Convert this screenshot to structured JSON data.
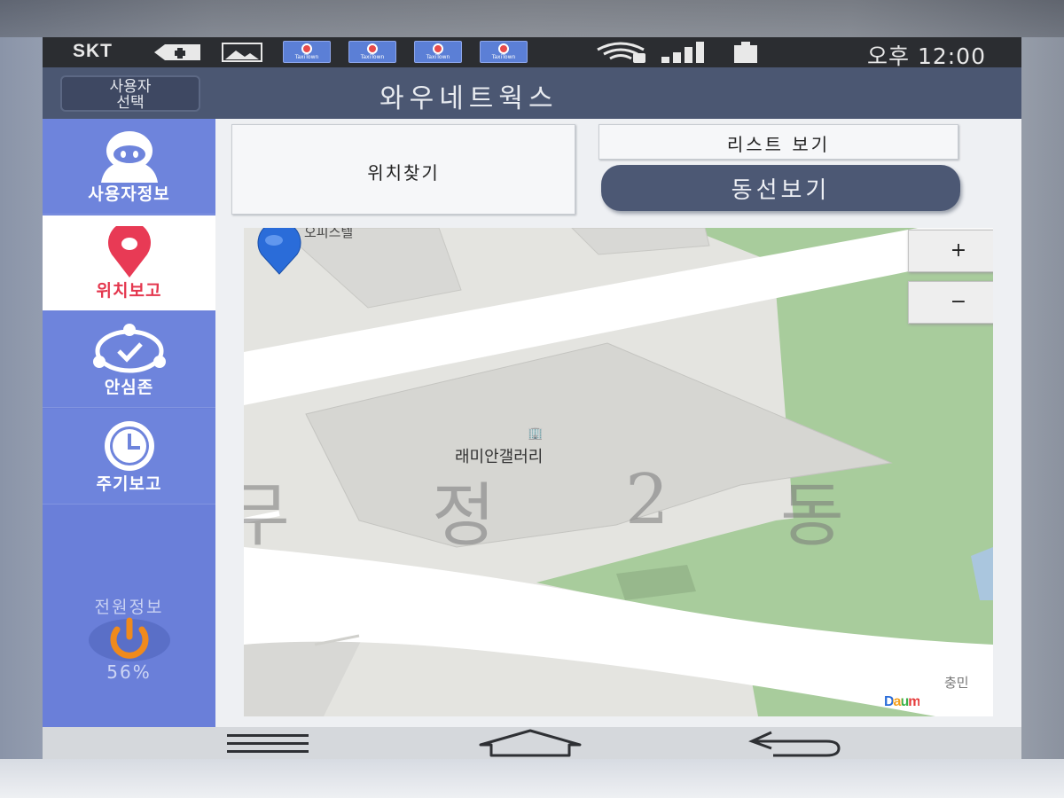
{
  "status_bar": {
    "carrier": "SKT",
    "time": "오후 12:00",
    "notification_app_label": "TaxiTown",
    "icons": [
      "plus-badge-icon",
      "image-icon",
      "app-notification-icon",
      "wifi-lock-icon",
      "signal-icon",
      "battery-icon"
    ]
  },
  "header": {
    "user_select_button_line1": "사용자",
    "user_select_button_line2": "선택",
    "title": "와우네트웍스"
  },
  "sidebar": {
    "items": [
      {
        "label": "사용자정보",
        "icon": "user-icon",
        "active": false
      },
      {
        "label": "위치보고",
        "icon": "location-pin-icon",
        "active": true
      },
      {
        "label": "안심존",
        "icon": "safe-zone-icon",
        "active": false
      },
      {
        "label": "주기보고",
        "icon": "clock-icon",
        "active": false
      }
    ],
    "power_label": "전원정보",
    "battery_percent_text": "56%",
    "battery_percent": 56
  },
  "buttons": {
    "find_location": "위치찾기",
    "list_view": "리스트 보기",
    "route_view": "동선보기"
  },
  "map": {
    "place_label_top": "오피스텔",
    "place_label": "래미안갤러리",
    "place_icon": "building-icon",
    "district_chars": [
      "무",
      "정",
      "2",
      "동"
    ],
    "street_label_corner": "충민",
    "zoom_in": "+",
    "zoom_out": "−",
    "provider_logo": "Daum",
    "colors": {
      "park": "#a8cc9c",
      "road": "#ffffff",
      "block": "#d9d9d6",
      "pin": "#2a6cd9"
    }
  },
  "colors": {
    "sidebar": "#6e84dc",
    "active_item_text": "#e4374e",
    "header": "#4b5772",
    "route_button": "#4c5874",
    "power_icon": "#f08a1c"
  }
}
